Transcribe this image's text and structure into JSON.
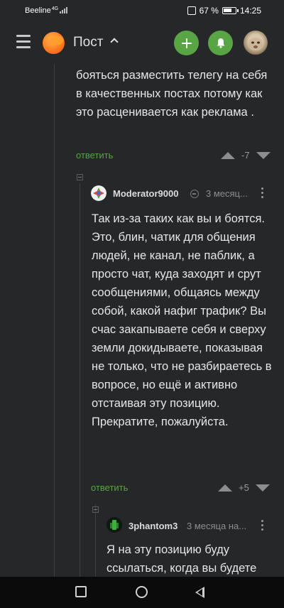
{
  "status_bar": {
    "carrier": "Beeline",
    "network": "4G",
    "battery": "67 %",
    "time": "14:25"
  },
  "app_bar": {
    "title": "Пост",
    "icons": [
      "hamburger-icon",
      "logo-icon",
      "chevron-up-icon",
      "plus-icon",
      "bell-icon",
      "avatar"
    ],
    "accent_color": "#59a444"
  },
  "comments": [
    {
      "text": "бояться разместить телегу на себя в качественных постах потому как это расценивается как реклама .",
      "reply_label": "ответить",
      "rating": "-7"
    },
    {
      "author": "Moderator9000",
      "time": "3 месяц...",
      "text": "Так из-за таких как вы и боятся.\nЭто, блин, чатик для общения людей, не канал, не паблик, а просто чат, куда заходят и срут сообщениями, общаясь между собой, какой нафиг трафик? Вы счас закапываете себя и сверху земли докидываете, показывая не только, что не разбираетесь в вопросе, но ещё и активно отстаивая эту позицию. Прекратите, пожалуйста.",
      "reply_label": "ответить",
      "rating": "+5"
    },
    {
      "author": "3phantom3",
      "time": "3 месяца на...",
      "text": "Я на эту позицию буду ссылаться, когда вы будете"
    }
  ]
}
